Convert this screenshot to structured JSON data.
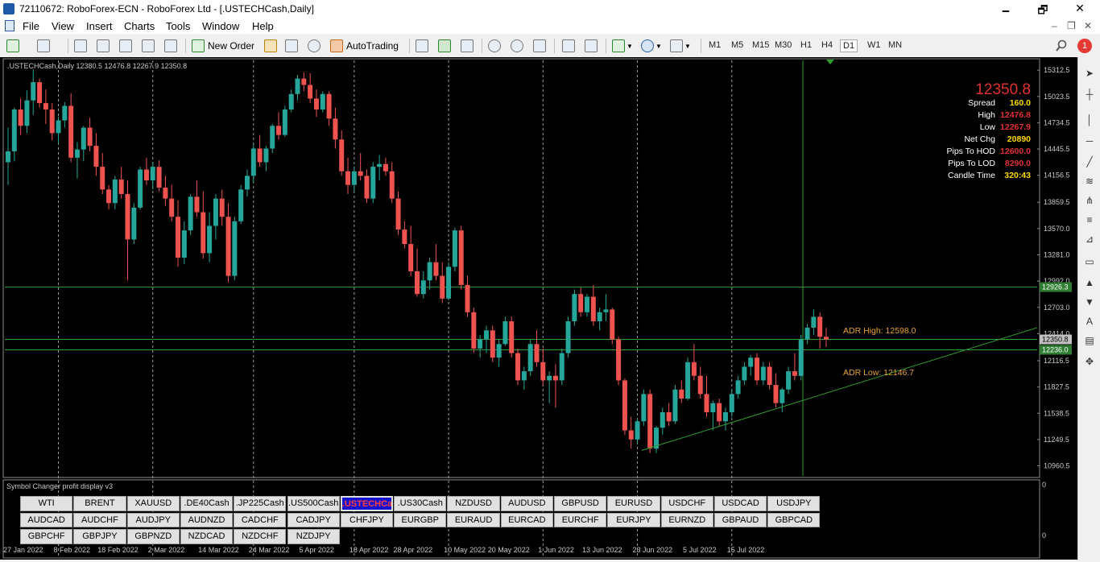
{
  "window": {
    "title": "72110672: RoboForex-ECN - RoboForex Ltd - [.USTECHCash,Daily]",
    "minimize": "🗕",
    "restore": "🗗",
    "close": "✕"
  },
  "menu": {
    "items": [
      "File",
      "View",
      "Insert",
      "Charts",
      "Tools",
      "Window",
      "Help"
    ],
    "mdi_min": "–",
    "mdi_restore": "❐",
    "mdi_close": "✕"
  },
  "toolbar": {
    "new_order": "New Order",
    "autotrading": "AutoTrading",
    "timeframes": [
      "M1",
      "M5",
      "M15",
      "M30",
      "H1",
      "H4",
      "D1",
      "W1",
      "MN"
    ],
    "selected_timeframe": "D1",
    "notification_badge": "1"
  },
  "chart": {
    "header": ".USTECHCash,Daily  12380.5 12476.8 12267.9 12350.8",
    "price_axis": [
      "15312.5",
      "15023.5",
      "14734.5",
      "14445.5",
      "14156.5",
      "13859.5",
      "13570.0",
      "13281.0",
      "12992.0",
      "12703.0",
      "12414.0",
      "12116.5",
      "11827.5",
      "11538.5",
      "11249.5",
      "10960.5"
    ],
    "price_tags": [
      {
        "label": "12926.3",
        "bg": "#2e7d32"
      },
      {
        "label": "12350.8",
        "bg": "#c0c0c0"
      },
      {
        "label": "12236.0",
        "bg": "#2e7d32"
      }
    ],
    "date_axis": [
      "27 Jan 2022",
      "8 Feb 2022",
      "18 Feb 2022",
      "2 Mar 2022",
      "14 Mar 2022",
      "24 Mar 2022",
      "5 Apr 2022",
      "18 Apr 2022",
      "28 Apr 2022",
      "10 May 2022",
      "20 May 2022",
      "1 Jun 2022",
      "13 Jun 2022",
      "23 Jun 2022",
      "5 Jul 2022",
      "15 Jul 2022"
    ],
    "adr_high": "ADR High: 12598.0",
    "adr_low": "ADR Low: 12146.7",
    "colors": {
      "bull": "#26a69a",
      "bear": "#ef5350",
      "grid": "#9aa09a",
      "level": "#2e9e2e",
      "text": "#c8c8c8"
    },
    "info_panel": {
      "price": "12350.8",
      "rows": [
        {
          "label": "Spread",
          "value": "160.0",
          "color": "#ffd700"
        },
        {
          "label": "High",
          "value": "12476.8",
          "color": "#e03030"
        },
        {
          "label": "Low",
          "value": "12267.9",
          "color": "#e03030"
        },
        {
          "label": "Net Chg",
          "value": "20890",
          "color": "#ffd700"
        },
        {
          "label": "Pips To HOD",
          "value": "12600.0",
          "color": "#e03030"
        },
        {
          "label": "Pips To LOD",
          "value": "8290.0",
          "color": "#e03030"
        },
        {
          "label": "Candle Time",
          "value": "320:43",
          "color": "#ffd700"
        }
      ]
    }
  },
  "sub_window": {
    "title": "Symbol Changer profit display v3",
    "axis": [
      "0",
      "0"
    ],
    "buttons": [
      [
        "WTI",
        "BRENT",
        "XAUUSD",
        ".DE40Cash",
        ".JP225Cash",
        ".US500Cash",
        ".USTECHCash",
        ".US30Cash",
        "NZDUSD",
        "AUDUSD",
        "GBPUSD",
        "EURUSD",
        "USDCHF",
        "USDCAD",
        "USDJPY"
      ],
      [
        "AUDCAD",
        "AUDCHF",
        "AUDJPY",
        "AUDNZD",
        "CADCHF",
        "CADJPY",
        "CHFJPY",
        "EURGBP",
        "EURAUD",
        "EURCAD",
        "EURCHF",
        "EURJPY",
        "EURNZD",
        "GBPAUD",
        "GBPCAD"
      ],
      [
        "GBPCHF",
        "GBPJPY",
        "GBPNZD",
        "NZDCAD",
        "NZDCHF",
        "NZDJPY"
      ]
    ],
    "selected": ".USTECHCash"
  },
  "chart_data": {
    "type": "candlestick",
    "symbol": ".USTECHCash",
    "timeframe": "Daily",
    "ylim": [
      10850,
      15420
    ],
    "levels": [
      12926.3,
      12236.0
    ],
    "bull_color": "#26a69a",
    "bear_color": "#ef5350",
    "trendline": [
      {
        "date": "14 Jun 2022",
        "value": 11130
      },
      {
        "date": "end",
        "value": 12480
      }
    ],
    "date_labels_at_candle_index": [
      0,
      8,
      15,
      23,
      31,
      39,
      47,
      55,
      62,
      70,
      77,
      85,
      92,
      100,
      108,
      115
    ],
    "ohlc": [
      [
        14300,
        14680,
        14050,
        14420
      ],
      [
        14420,
        14900,
        14310,
        14880
      ],
      [
        14880,
        15000,
        14600,
        14700
      ],
      [
        14700,
        15090,
        14620,
        14980
      ],
      [
        14980,
        15320,
        14820,
        15180
      ],
      [
        15180,
        15220,
        14900,
        14950
      ],
      [
        14950,
        15100,
        14720,
        14880
      ],
      [
        14880,
        14950,
        14540,
        14620
      ],
      [
        14620,
        14800,
        14500,
        14760
      ],
      [
        14760,
        14960,
        14680,
        14920
      ],
      [
        14920,
        15060,
        14300,
        14350
      ],
      [
        14350,
        14520,
        14120,
        14440
      ],
      [
        14440,
        14700,
        14310,
        14680
      ],
      [
        14680,
        14790,
        14420,
        14480
      ],
      [
        14480,
        14620,
        14150,
        14250
      ],
      [
        14250,
        14400,
        13950,
        14000
      ],
      [
        14000,
        14050,
        13780,
        13850
      ],
      [
        13850,
        14150,
        13780,
        14110
      ],
      [
        14110,
        14250,
        13900,
        13950
      ],
      [
        13950,
        14100,
        13000,
        13450
      ],
      [
        13450,
        13850,
        13400,
        13800
      ],
      [
        13800,
        14250,
        13780,
        14220
      ],
      [
        14220,
        14350,
        14050,
        14100
      ],
      [
        14100,
        14300,
        14000,
        14250
      ],
      [
        14250,
        14320,
        13980,
        14020
      ],
      [
        14020,
        14150,
        13820,
        13900
      ],
      [
        13900,
        14050,
        13650,
        13700
      ],
      [
        13700,
        13880,
        13150,
        13250
      ],
      [
        13250,
        13650,
        13180,
        13550
      ],
      [
        13550,
        13950,
        13500,
        13920
      ],
      [
        13920,
        14100,
        13700,
        13750
      ],
      [
        13750,
        13980,
        13240,
        13300
      ],
      [
        13300,
        13750,
        13200,
        13600
      ],
      [
        13600,
        13950,
        13450,
        13900
      ],
      [
        13900,
        14000,
        13600,
        13700
      ],
      [
        13700,
        13850,
        12980,
        13050
      ],
      [
        13050,
        13700,
        13000,
        13650
      ],
      [
        13650,
        14050,
        13620,
        14000
      ],
      [
        14000,
        14220,
        13920,
        14150
      ],
      [
        14150,
        14500,
        14080,
        14450
      ],
      [
        14450,
        14600,
        14250,
        14300
      ],
      [
        14300,
        14480,
        14200,
        14450
      ],
      [
        14450,
        14720,
        14400,
        14700
      ],
      [
        14700,
        14850,
        14550,
        14600
      ],
      [
        14600,
        14920,
        14580,
        14880
      ],
      [
        14880,
        15100,
        14850,
        15050
      ],
      [
        15050,
        15260,
        14980,
        15220
      ],
      [
        15220,
        15290,
        15080,
        15150
      ],
      [
        15150,
        15280,
        14950,
        15000
      ],
      [
        15000,
        15100,
        14800,
        14880
      ],
      [
        14880,
        15080,
        14850,
        15050
      ],
      [
        15050,
        15080,
        14700,
        14780
      ],
      [
        14780,
        14900,
        14450,
        14550
      ],
      [
        14550,
        14650,
        14150,
        14200
      ],
      [
        14200,
        14350,
        13950,
        14050
      ],
      [
        14050,
        14250,
        13980,
        14200
      ],
      [
        14200,
        14400,
        14100,
        14150
      ],
      [
        14150,
        14220,
        13850,
        13900
      ],
      [
        13900,
        14300,
        13850,
        14250
      ],
      [
        14250,
        14380,
        14100,
        14280
      ],
      [
        14280,
        14350,
        14150,
        14200
      ],
      [
        14200,
        14300,
        13850,
        13900
      ],
      [
        13900,
        13980,
        13500,
        13560
      ],
      [
        13560,
        13650,
        13350,
        13400
      ],
      [
        13400,
        13600,
        13050,
        13100
      ],
      [
        13100,
        13350,
        12820,
        12850
      ],
      [
        12850,
        13100,
        12800,
        13000
      ],
      [
        13000,
        13250,
        12900,
        13200
      ],
      [
        13200,
        13400,
        13000,
        13050
      ],
      [
        13050,
        13200,
        12750,
        12800
      ],
      [
        12800,
        13200,
        12780,
        13150
      ],
      [
        13150,
        13580,
        13100,
        13550
      ],
      [
        13550,
        13600,
        12900,
        12950
      ],
      [
        12950,
        13050,
        12600,
        12650
      ],
      [
        12650,
        12700,
        12200,
        12250
      ],
      [
        12250,
        12400,
        12150,
        12350
      ],
      [
        12350,
        12500,
        12200,
        12450
      ],
      [
        12450,
        12500,
        12100,
        12150
      ],
      [
        12150,
        12350,
        12050,
        12300
      ],
      [
        12300,
        12600,
        12280,
        12550
      ],
      [
        12550,
        12600,
        12150,
        12200
      ],
      [
        12200,
        12250,
        11850,
        11900
      ],
      [
        11900,
        12050,
        11800,
        12000
      ],
      [
        12000,
        12350,
        11950,
        12300
      ],
      [
        12300,
        12450,
        12050,
        12100
      ],
      [
        12100,
        12250,
        11850,
        11900
      ],
      [
        11900,
        12000,
        11650,
        11950
      ],
      [
        11950,
        12080,
        11600,
        11900
      ],
      [
        11900,
        12250,
        11850,
        12200
      ],
      [
        12200,
        12600,
        12150,
        12550
      ],
      [
        12550,
        12900,
        12500,
        12850
      ],
      [
        12850,
        12920,
        12600,
        12650
      ],
      [
        12650,
        12850,
        12600,
        12820
      ],
      [
        12820,
        12950,
        12500,
        12550
      ],
      [
        12550,
        12700,
        12450,
        12650
      ],
      [
        12650,
        12850,
        12550,
        12680
      ],
      [
        12680,
        12700,
        12300,
        12350
      ],
      [
        12350,
        12380,
        11850,
        11900
      ],
      [
        11900,
        11920,
        11300,
        11350
      ],
      [
        11350,
        11500,
        11150,
        11250
      ],
      [
        11250,
        11480,
        11200,
        11450
      ],
      [
        11450,
        11800,
        11400,
        11750
      ],
      [
        11750,
        11800,
        11100,
        11150
      ],
      [
        11150,
        11400,
        11100,
        11380
      ],
      [
        11380,
        11600,
        11300,
        11550
      ],
      [
        11550,
        11650,
        11400,
        11450
      ],
      [
        11450,
        11850,
        11420,
        11800
      ],
      [
        11800,
        11900,
        11650,
        11700
      ],
      [
        11700,
        12150,
        11680,
        12100
      ],
      [
        12100,
        12300,
        11900,
        11950
      ],
      [
        11950,
        12050,
        11700,
        11750
      ],
      [
        11750,
        11950,
        11500,
        11550
      ],
      [
        11550,
        11680,
        11350,
        11650
      ],
      [
        11650,
        11700,
        11400,
        11450
      ],
      [
        11450,
        11600,
        11350,
        11550
      ],
      [
        11550,
        11800,
        11500,
        11750
      ],
      [
        11750,
        11950,
        11700,
        11900
      ],
      [
        11900,
        12100,
        11850,
        12050
      ],
      [
        12050,
        12180,
        11950,
        12150
      ],
      [
        12150,
        12200,
        11850,
        11900
      ],
      [
        11900,
        12100,
        11850,
        12050
      ],
      [
        12050,
        12100,
        11800,
        11850
      ],
      [
        11850,
        11980,
        11600,
        11650
      ],
      [
        11650,
        11820,
        11550,
        11800
      ],
      [
        11800,
        12050,
        11750,
        12000
      ],
      [
        12000,
        12200,
        11900,
        11950
      ],
      [
        11950,
        12400,
        11900,
        12350
      ],
      [
        12350,
        12520,
        12300,
        12480
      ],
      [
        12480,
        12680,
        12400,
        12600
      ],
      [
        12600,
        12650,
        12250,
        12380
      ],
      [
        12380,
        12477,
        12268,
        12351
      ]
    ]
  }
}
